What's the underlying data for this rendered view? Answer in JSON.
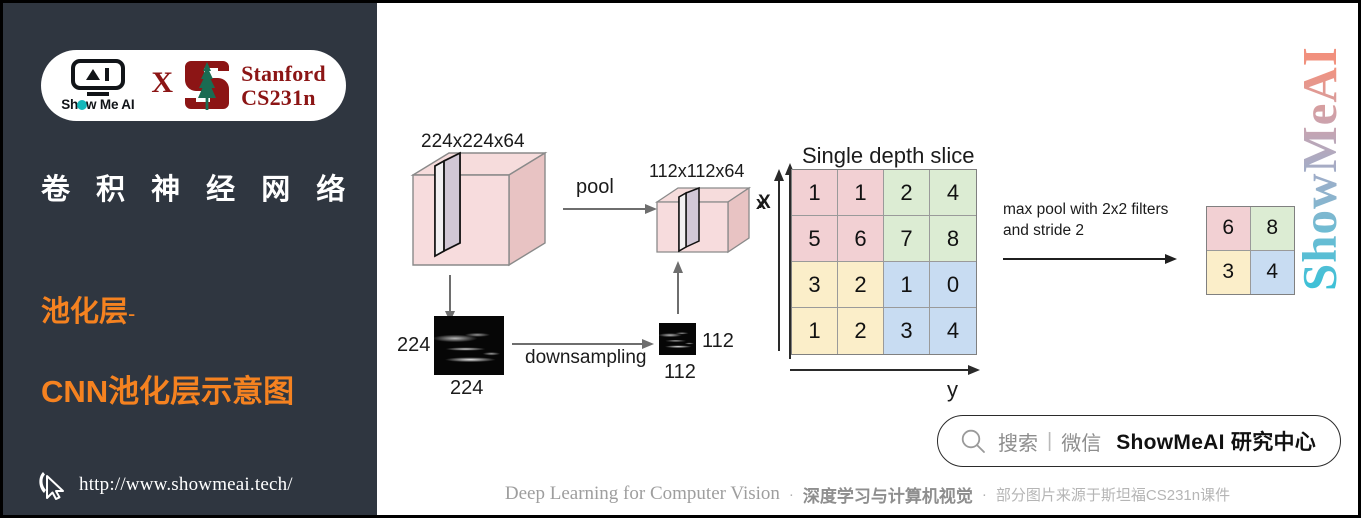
{
  "sidebar": {
    "logo": {
      "show_me_ai_text": "Sh",
      "show_me_ai_text_2": "w Me AI",
      "x_separator": "X",
      "stanford_line1": "Stanford",
      "stanford_line2": "CS231n"
    },
    "title": "卷 积 神 经 网 络",
    "subtitle_1": "池化层",
    "subtitle_1_dash": "-",
    "subtitle_2": "CNN池化层示意图",
    "site_url": "http://www.showmeai.tech/",
    "background_color": "#2f3640",
    "accent_color": "#f58220"
  },
  "diagram": {
    "input_volume_label": "224x224x64",
    "output_volume_label": "112x112x64",
    "pool_label": "pool",
    "downsampling_label": "downsampling",
    "input_h_label": "224",
    "input_w_label": "224",
    "output_h_label": "112",
    "output_w_label": "112",
    "axis_x_label": "X",
    "slice_title": "Single depth slice",
    "slice_axis_x": "x",
    "slice_axis_y": "y",
    "maxpool_line1": "max pool with 2x2 filters",
    "maxpool_line2": "and stride 2"
  },
  "chart_data": {
    "type": "heatmap",
    "title": "Single depth slice",
    "xlabel": "y",
    "ylabel": "x",
    "input_grid": {
      "rows": 4,
      "cols": 4,
      "values": [
        [
          1,
          1,
          2,
          4
        ],
        [
          5,
          6,
          7,
          8
        ],
        [
          3,
          2,
          1,
          0
        ],
        [
          1,
          2,
          3,
          4
        ]
      ],
      "quadrant_colors": {
        "top_left": "#f2d0d3",
        "top_right": "#d9ecd1",
        "bottom_left": "#fbeec9",
        "bottom_right": "#c8dcf2"
      }
    },
    "output_grid": {
      "rows": 2,
      "cols": 2,
      "values": [
        [
          6,
          8
        ],
        [
          3,
          4
        ]
      ],
      "cell_colors": [
        [
          "#f2d0d3",
          "#d9ecd1"
        ],
        [
          "#fbeec9",
          "#c8dcf2"
        ]
      ]
    },
    "operation": "max pool with 2x2 filters and stride 2"
  },
  "wechat": {
    "search_label": "搜索",
    "separator": "|",
    "channel_label": "微信",
    "account_name": "ShowMeAI 研究中心"
  },
  "footer": {
    "english": "Deep Learning for Computer Vision",
    "dot1": "·",
    "chinese_bold": "深度学习与计算机视觉",
    "dot2": "·",
    "chinese_small": "部分图片来源于斯坦福CS231n课件"
  },
  "watermark": {
    "text": "ShowMeAI"
  }
}
